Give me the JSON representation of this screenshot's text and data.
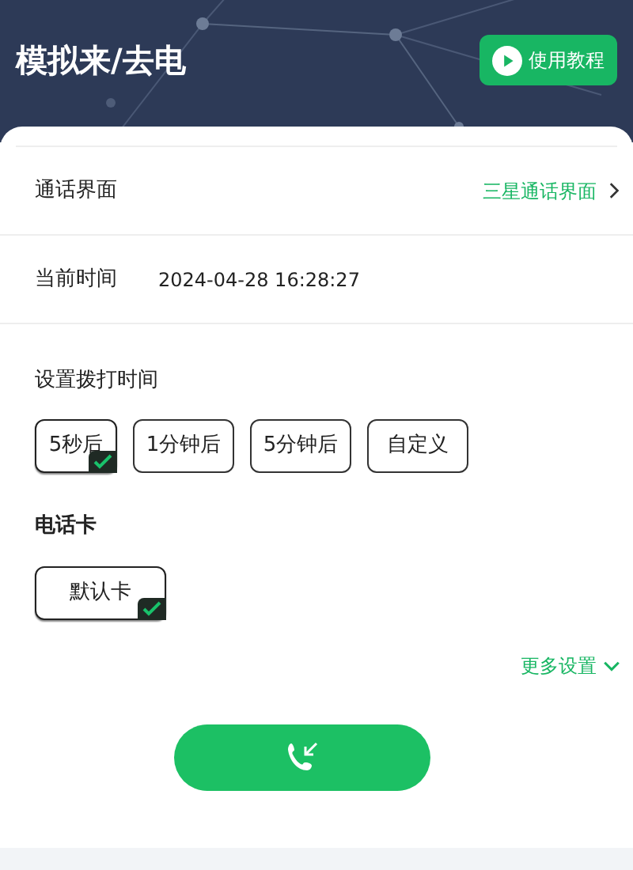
{
  "header": {
    "title": "模拟来/去电",
    "tutorial_button": "使用教程"
  },
  "rows": [
    {
      "label": "通话界面",
      "value": "三星通话界面",
      "kind": "link"
    },
    {
      "label": "当前时间",
      "value": "2024-04-28 16:28:27",
      "kind": "plain"
    }
  ],
  "dial_time": {
    "title": "设置拨打时间",
    "options": [
      {
        "label": "5秒后",
        "selected": true
      },
      {
        "label": "1分钟后",
        "selected": false
      },
      {
        "label": "5分钟后",
        "selected": false
      },
      {
        "label": "自定义",
        "selected": false
      }
    ]
  },
  "sim_card": {
    "title": "电话卡",
    "options": [
      {
        "label": "默认卡",
        "selected": true
      }
    ]
  },
  "more_settings": "更多设置"
}
